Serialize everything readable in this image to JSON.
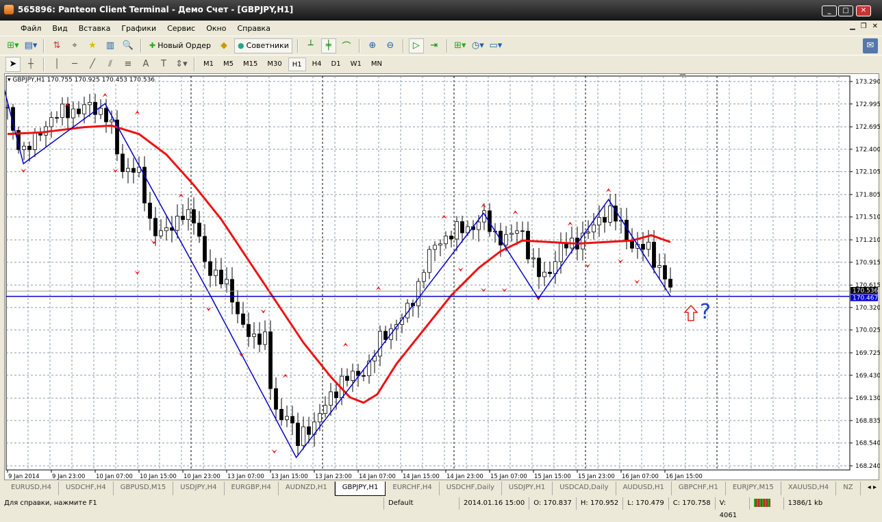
{
  "window": {
    "title": "565896: Panteon Client Terminal - Демо Счет - [GBPJPY,H1]",
    "min": "_",
    "max": "□",
    "close": "✕"
  },
  "menu": [
    "Файл",
    "Вид",
    "Вставка",
    "Графики",
    "Сервис",
    "Окно",
    "Справка"
  ],
  "toolbar": {
    "new_order": "Новый Ордер",
    "experts": "Советники"
  },
  "timeframes": [
    "M1",
    "M5",
    "M15",
    "M30",
    "H1",
    "H4",
    "D1",
    "W1",
    "MN"
  ],
  "active_timeframe": "H1",
  "chart_header": "GBPJPY,H1  170.755 170.925 170.453 170.536",
  "annotation": "?",
  "tabs": [
    "EURUSD,H4",
    "USDCHF,H4",
    "GBPUSD,M15",
    "USDJPY,H4",
    "EURGBP,H4",
    "AUDNZD,H1",
    "GBPJPY,H1",
    "EURCHF,H4",
    "USDCHF,Daily",
    "USDJPY,H1",
    "USDCAD,Daily",
    "AUDUSD,H1",
    "GBPCHF,H1",
    "EURJPY,M15",
    "XAUUSD,H4",
    "NZ"
  ],
  "active_tab": "GBPJPY,H1",
  "status": {
    "help": "Для справки, нажмите F1",
    "profile": "Default",
    "time": "2014.01.16 15:00",
    "open": "O: 170.837",
    "high": "H: 170.952",
    "low": "L: 170.479",
    "close": "C: 170.758",
    "volume": "V: 4061",
    "traffic": "1386/1 kb"
  },
  "colors": {
    "bull": "#ffffff",
    "bear": "#000000",
    "ma": "#ee1111",
    "zigzag": "#0000cc",
    "fractal": "#ee1111",
    "hline": "#0000cc"
  },
  "chart_data": {
    "type": "candlestick",
    "symbol": "GBPJPY",
    "timeframe": "H1",
    "ylim": [
      168.24,
      173.29
    ],
    "y_ticks": [
      "173.290",
      "172.995",
      "172.695",
      "172.400",
      "172.105",
      "171.805",
      "171.510",
      "171.210",
      "170.915",
      "170.615",
      "170.320",
      "170.025",
      "169.725",
      "169.430",
      "169.130",
      "168.835",
      "168.540",
      "168.240"
    ],
    "x_ticks": [
      {
        "bar": 0,
        "label": "9 Jan 2014"
      },
      {
        "bar": 8,
        "label": "9 Jan 23:00"
      },
      {
        "bar": 16,
        "label": "10 Jan 07:00"
      },
      {
        "bar": 24,
        "label": "10 Jan 15:00"
      },
      {
        "bar": 32,
        "label": "10 Jan 23:00"
      },
      {
        "bar": 40,
        "label": "13 Jan 07:00"
      },
      {
        "bar": 48,
        "label": "13 Jan 15:00"
      },
      {
        "bar": 56,
        "label": "13 Jan 23:00"
      },
      {
        "bar": 64,
        "label": "14 Jan 07:00"
      },
      {
        "bar": 72,
        "label": "14 Jan 15:00"
      },
      {
        "bar": 80,
        "label": "14 Jan 23:00"
      },
      {
        "bar": 88,
        "label": "15 Jan 07:00"
      },
      {
        "bar": 96,
        "label": "15 Jan 15:00"
      },
      {
        "bar": 104,
        "label": "15 Jan 23:00"
      },
      {
        "bar": 112,
        "label": "16 Jan 07:00"
      },
      {
        "bar": 120,
        "label": "16 Jan 15:00"
      }
    ],
    "close_path": [
      [
        0,
        172.9
      ],
      [
        1,
        172.6
      ],
      [
        3,
        172.4
      ],
      [
        5,
        172.5
      ],
      [
        7.5,
        172.8
      ],
      [
        11,
        172.9
      ],
      [
        15,
        172.95
      ],
      [
        17.7,
        172.9
      ],
      [
        19.4,
        172.6
      ],
      [
        20.6,
        172.1
      ],
      [
        22.5,
        172.2
      ],
      [
        24.4,
        172.0
      ],
      [
        25.6,
        171.5
      ],
      [
        27.5,
        171.3
      ],
      [
        29.4,
        171.3
      ],
      [
        31.9,
        171.6
      ],
      [
        34.4,
        171.4
      ],
      [
        36.2,
        170.9
      ],
      [
        38.1,
        170.7
      ],
      [
        40.6,
        170.6
      ],
      [
        42.5,
        170.1
      ],
      [
        44.4,
        169.9
      ],
      [
        46.9,
        170.0
      ],
      [
        48.1,
        169.2
      ],
      [
        49.4,
        168.8
      ],
      [
        51.2,
        169.0
      ],
      [
        52.7,
        168.5
      ],
      [
        54.4,
        168.7
      ],
      [
        56.9,
        168.9
      ],
      [
        58.7,
        169.1
      ],
      [
        61.2,
        169.4
      ],
      [
        63.7,
        169.4
      ],
      [
        66.2,
        169.6
      ],
      [
        68.1,
        169.9
      ],
      [
        70.6,
        170.1
      ],
      [
        72.5,
        170.2
      ],
      [
        74.4,
        170.5
      ],
      [
        76.2,
        170.9
      ],
      [
        78.7,
        171.2
      ],
      [
        81.2,
        171.3
      ],
      [
        85,
        171.4
      ],
      [
        86.9,
        171.5
      ],
      [
        88.7,
        171.3
      ],
      [
        91.2,
        171.2
      ],
      [
        93.7,
        171.4
      ],
      [
        95.6,
        170.9
      ],
      [
        97.5,
        170.7
      ],
      [
        98.7,
        170.8
      ],
      [
        101.2,
        171.1
      ],
      [
        103.7,
        171.2
      ],
      [
        106.2,
        171.3
      ],
      [
        108.1,
        171.5
      ],
      [
        109.7,
        171.6
      ],
      [
        111.9,
        171.4
      ],
      [
        114.4,
        171.1
      ],
      [
        116.9,
        171.1
      ],
      [
        119.4,
        170.8
      ],
      [
        121,
        170.54
      ]
    ],
    "moving_average": [
      [
        0,
        172.6
      ],
      [
        6,
        172.62
      ],
      [
        14,
        172.69
      ],
      [
        19,
        172.71
      ],
      [
        24,
        172.6
      ],
      [
        29,
        172.33
      ],
      [
        34,
        171.93
      ],
      [
        39,
        171.48
      ],
      [
        44,
        170.94
      ],
      [
        49,
        170.4
      ],
      [
        54,
        169.86
      ],
      [
        59,
        169.41
      ],
      [
        62.5,
        169.14
      ],
      [
        65,
        169.07
      ],
      [
        67.5,
        169.18
      ],
      [
        71,
        169.58
      ],
      [
        76,
        170.03
      ],
      [
        81,
        170.48
      ],
      [
        86,
        170.84
      ],
      [
        90,
        171.06
      ],
      [
        94,
        171.2
      ],
      [
        99,
        171.18
      ],
      [
        104,
        171.16
      ],
      [
        109,
        171.18
      ],
      [
        114,
        171.2
      ],
      [
        117.5,
        171.27
      ],
      [
        121,
        171.18
      ]
    ],
    "zigzag": [
      [
        -1,
        173.3
      ],
      [
        2.9,
        172.21
      ],
      [
        17.8,
        173.0
      ],
      [
        37,
        170.48
      ],
      [
        52.7,
        168.35
      ],
      [
        86.9,
        171.56
      ],
      [
        96.9,
        170.44
      ],
      [
        109.7,
        171.74
      ],
      [
        121,
        170.47
      ]
    ],
    "fractals_up": [
      [
        10.9,
        172.98
      ],
      [
        17.8,
        173.11
      ],
      [
        23.7,
        172.88
      ],
      [
        31.7,
        171.79
      ],
      [
        50.7,
        169.42
      ],
      [
        61.7,
        169.83
      ],
      [
        67.7,
        170.57
      ],
      [
        79.7,
        171.51
      ],
      [
        86.9,
        171.66
      ],
      [
        92.7,
        171.57
      ],
      [
        102.7,
        171.42
      ],
      [
        109.7,
        171.86
      ]
    ],
    "fractals_down": [
      [
        2.9,
        172.12
      ],
      [
        19.7,
        172.12
      ],
      [
        23.7,
        170.78
      ],
      [
        26.7,
        171.18
      ],
      [
        36.7,
        170.3
      ],
      [
        42.7,
        169.7
      ],
      [
        46.7,
        170.27
      ],
      [
        48.7,
        168.43
      ],
      [
        82.7,
        170.82
      ],
      [
        86.9,
        170.55
      ],
      [
        90.7,
        170.55
      ],
      [
        96.9,
        170.44
      ],
      [
        105.9,
        170.87
      ],
      [
        111.9,
        170.93
      ],
      [
        114.9,
        170.66
      ]
    ],
    "bid_line": 170.536,
    "level_line": 170.467,
    "bid_label": "170.536",
    "level_label": "170.467"
  }
}
